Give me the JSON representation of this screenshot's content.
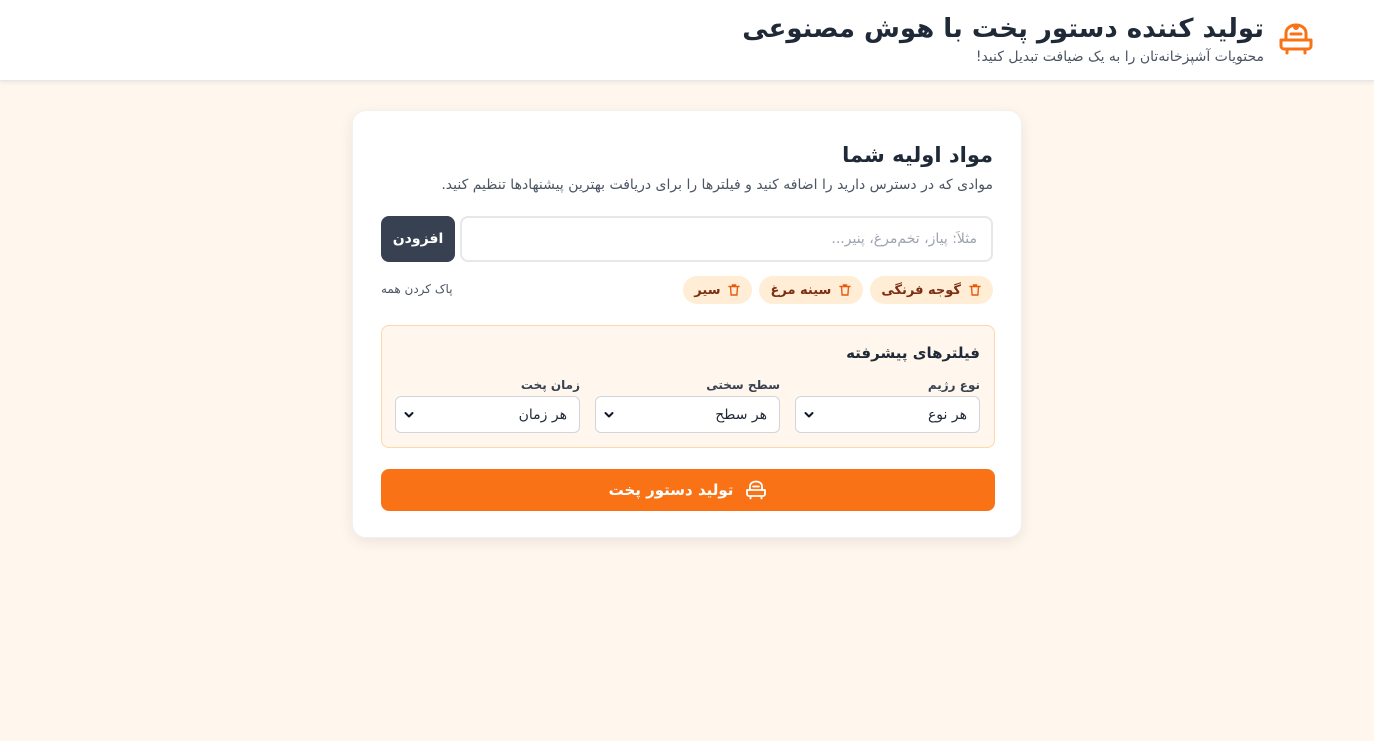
{
  "header": {
    "title": "تولید کننده دستور پخت با هوش مصنوعی",
    "subtitle": "محتویات آشپزخانه‌تان را به یک ضیافت تبدیل کنید!",
    "logo_icon": "cooking-pot-icon",
    "accent_color": "#f97316"
  },
  "ingredients": {
    "title": "مواد اولیه شما",
    "description": "موادی که در دسترس دارید را اضافه کنید و فیلترها را برای دریافت بهترین پیشنهادها تنظیم کنید.",
    "input": {
      "value": "",
      "placeholder": "مثلاً: پیاز، تخم‌مرغ، پنیر..."
    },
    "add_label": "افزودن",
    "chips": [
      {
        "label": "گوجه فرنگی",
        "icon": "trash-icon"
      },
      {
        "label": "سینه مرغ",
        "icon": "trash-icon"
      },
      {
        "label": "سیر",
        "icon": "trash-icon"
      }
    ],
    "clear_all_label": "پاک کردن همه"
  },
  "filters": {
    "title": "فیلترهای پیشرفته",
    "diet": {
      "label": "نوع رژیم",
      "value": "هر نوع"
    },
    "difficulty": {
      "label": "سطح سختی",
      "value": "هر سطح"
    },
    "time": {
      "label": "زمان پخت",
      "value": "هر زمان"
    }
  },
  "generate": {
    "label": "تولید دستور پخت",
    "icon": "cooking-pot-icon",
    "color": "#f97316"
  }
}
